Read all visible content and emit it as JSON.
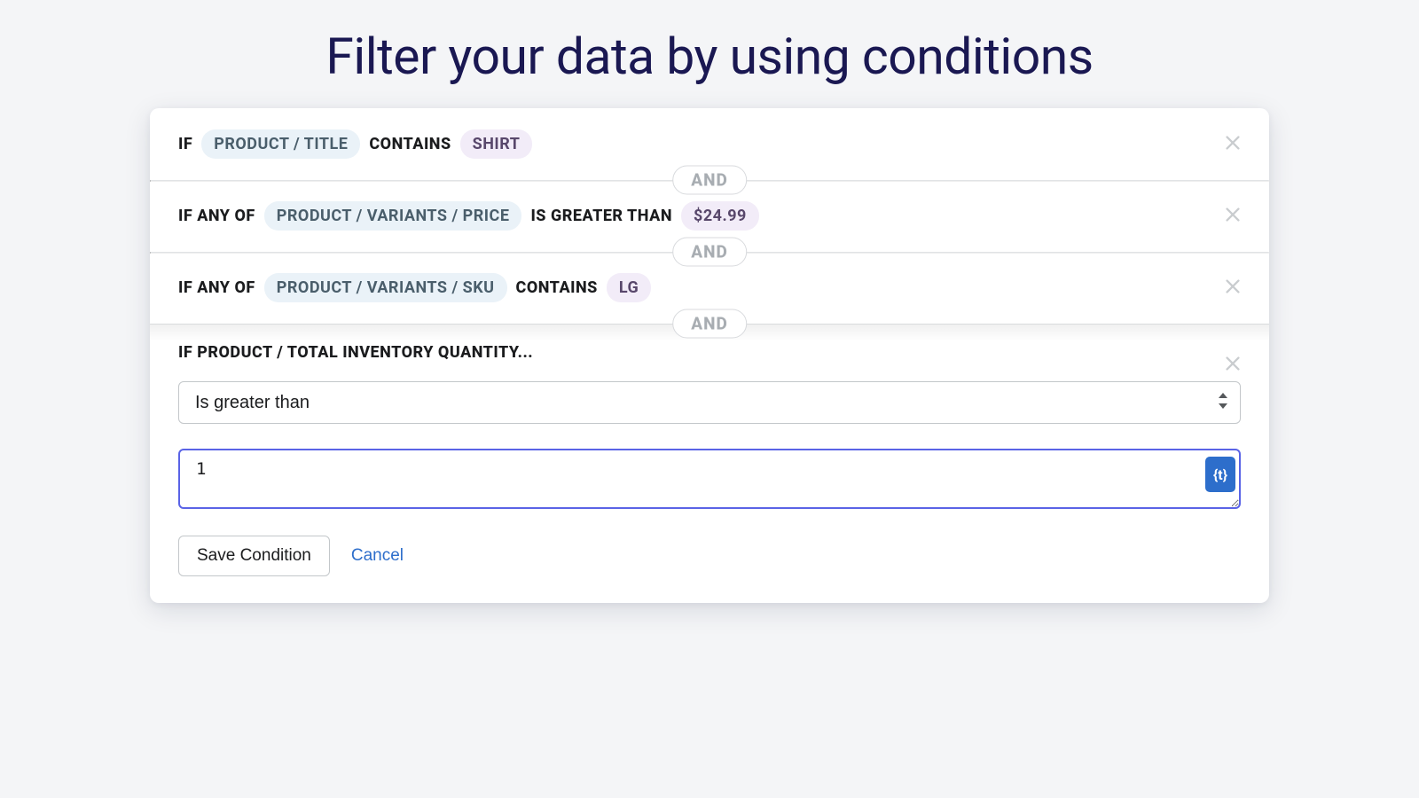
{
  "header": {
    "title": "Filter your data by using conditions"
  },
  "separator": {
    "label": "AND"
  },
  "conditions": [
    {
      "prefix": "IF",
      "field": "PRODUCT / TITLE",
      "operator": "CONTAINS",
      "value": "SHIRT"
    },
    {
      "prefix": "IF ANY OF",
      "field": "PRODUCT / VARIANTS / PRICE",
      "operator": "IS GREATER THAN",
      "value": "$24.99"
    },
    {
      "prefix": "IF ANY OF",
      "field": "PRODUCT / VARIANTS / SKU",
      "operator": "CONTAINS",
      "value": "LG"
    }
  ],
  "editing": {
    "title": "IF PRODUCT / TOTAL INVENTORY QUANTITY...",
    "operator_selected": "Is greater than",
    "value": "1",
    "token_button_label": "{t}",
    "save_label": "Save Condition",
    "cancel_label": "Cancel"
  }
}
